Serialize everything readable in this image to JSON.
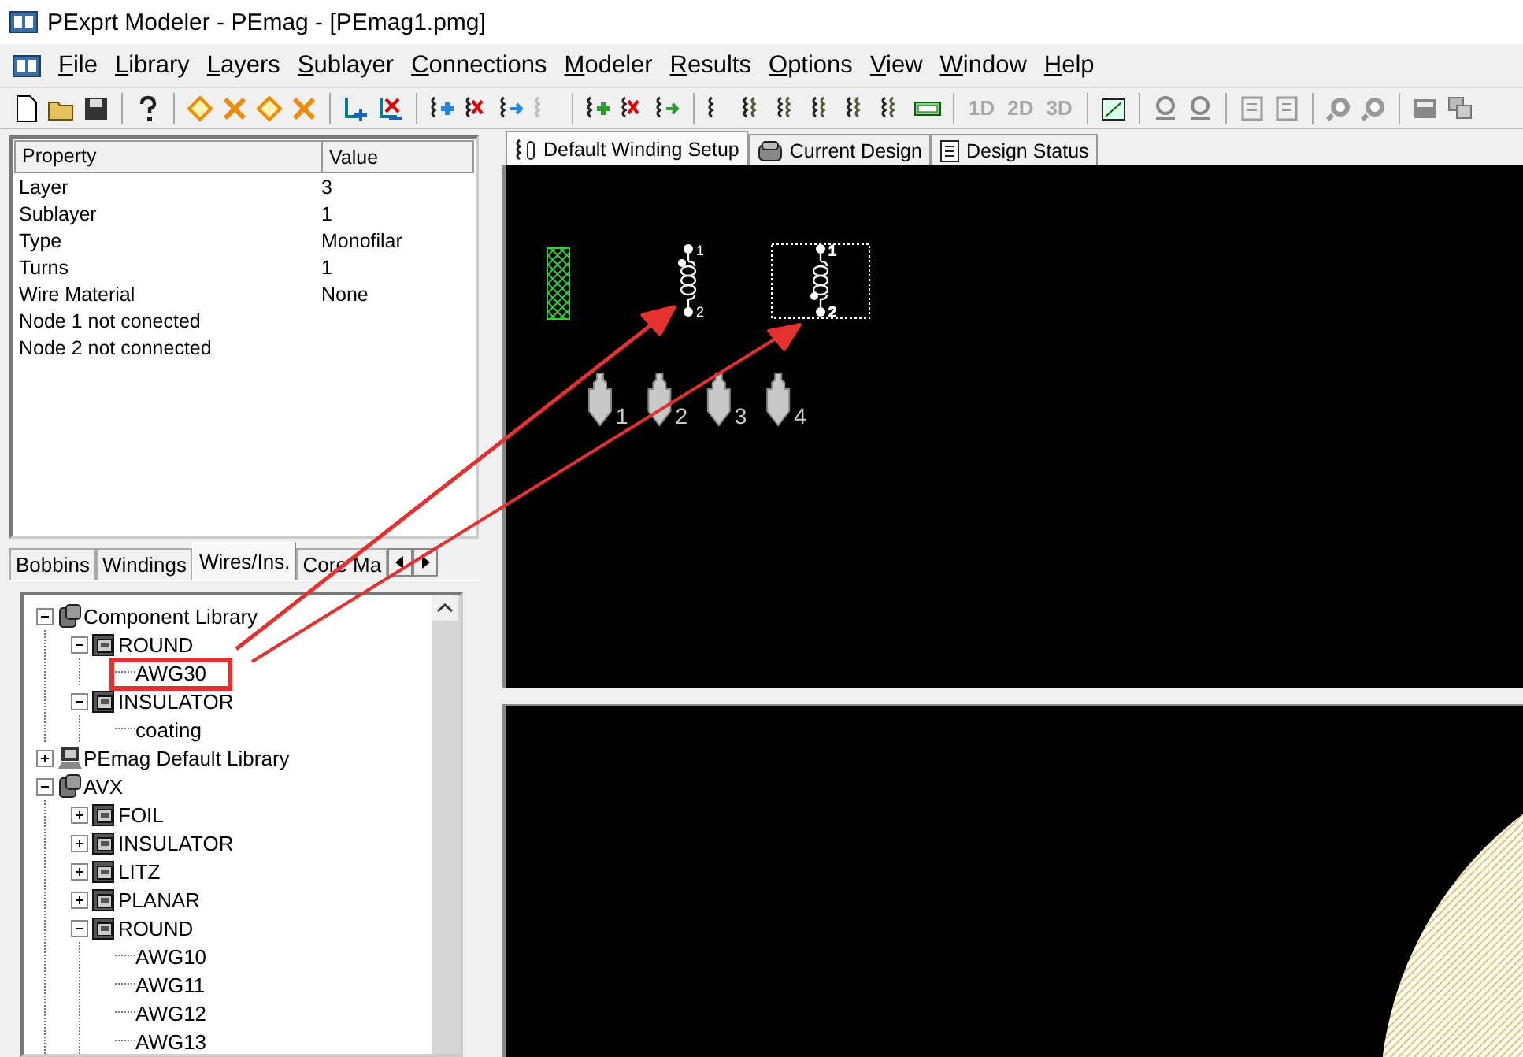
{
  "window": {
    "title": "PExprt Modeler - PEmag - [PEmag1.pmg]"
  },
  "menu": [
    "File",
    "Library",
    "Layers",
    "Sublayer",
    "Connections",
    "Modeler",
    "Results",
    "Options",
    "View",
    "Window",
    "Help"
  ],
  "toolbar": {
    "dimension_buttons": [
      {
        "label": "1D",
        "disabled": true
      },
      {
        "label": "2D",
        "disabled": true
      },
      {
        "label": "3D",
        "disabled": true
      }
    ]
  },
  "properties": {
    "columns": [
      "Property",
      "Value"
    ],
    "rows": [
      {
        "property": "Layer",
        "value": "3"
      },
      {
        "property": "Sublayer",
        "value": "1"
      },
      {
        "property": "Type",
        "value": "Monofilar"
      },
      {
        "property": "Turns",
        "value": "1"
      },
      {
        "property": "Wire Material",
        "value": "None"
      },
      {
        "property": "Node 1 not conected"
      },
      {
        "property": "Node 2 not connected"
      }
    ]
  },
  "library_tabs": [
    {
      "label": "Bobbins",
      "selected": false
    },
    {
      "label": "Windings",
      "selected": false
    },
    {
      "label": "Wires/Ins.",
      "selected": true
    },
    {
      "label": "Core Ma",
      "selected": false
    }
  ],
  "tree": {
    "items": [
      {
        "label": "Component Library",
        "kind": "library",
        "expanded": true,
        "children": [
          {
            "label": "ROUND",
            "kind": "folder",
            "expanded": true,
            "children": [
              {
                "label": "AWG30",
                "kind": "leaf"
              }
            ]
          },
          {
            "label": "INSULATOR",
            "kind": "folder",
            "expanded": true,
            "children": [
              {
                "label": "coating",
                "kind": "leaf"
              }
            ]
          }
        ]
      },
      {
        "label": "PEmag Default Library",
        "kind": "computer",
        "expanded": false
      },
      {
        "label": "AVX",
        "kind": "library",
        "expanded": true,
        "children": [
          {
            "label": "FOIL",
            "kind": "folder",
            "expanded": false
          },
          {
            "label": "INSULATOR",
            "kind": "folder",
            "expanded": false
          },
          {
            "label": "LITZ",
            "kind": "folder",
            "expanded": false
          },
          {
            "label": "PLANAR",
            "kind": "folder",
            "expanded": false
          },
          {
            "label": "ROUND",
            "kind": "folder",
            "expanded": true,
            "children": [
              {
                "label": "AWG10",
                "kind": "leaf"
              },
              {
                "label": "AWG11",
                "kind": "leaf"
              },
              {
                "label": "AWG12",
                "kind": "leaf"
              },
              {
                "label": "AWG13",
                "kind": "leaf"
              }
            ]
          }
        ]
      }
    ]
  },
  "view_tabs": [
    {
      "label": "Default Winding Setup",
      "kind": "winding",
      "selected": true
    },
    {
      "label": "Current Design",
      "kind": "design",
      "selected": false
    },
    {
      "label": "Design Status",
      "kind": "status",
      "selected": false
    }
  ],
  "canvas": {
    "inductors": [
      {
        "selected": false,
        "pin_labels": [
          "1",
          "2"
        ]
      },
      {
        "selected": true,
        "pin_labels": [
          "1",
          "2"
        ]
      }
    ],
    "terminals": [
      {
        "label": "1"
      },
      {
        "label": "2"
      },
      {
        "label": "3"
      },
      {
        "label": "4"
      }
    ]
  }
}
